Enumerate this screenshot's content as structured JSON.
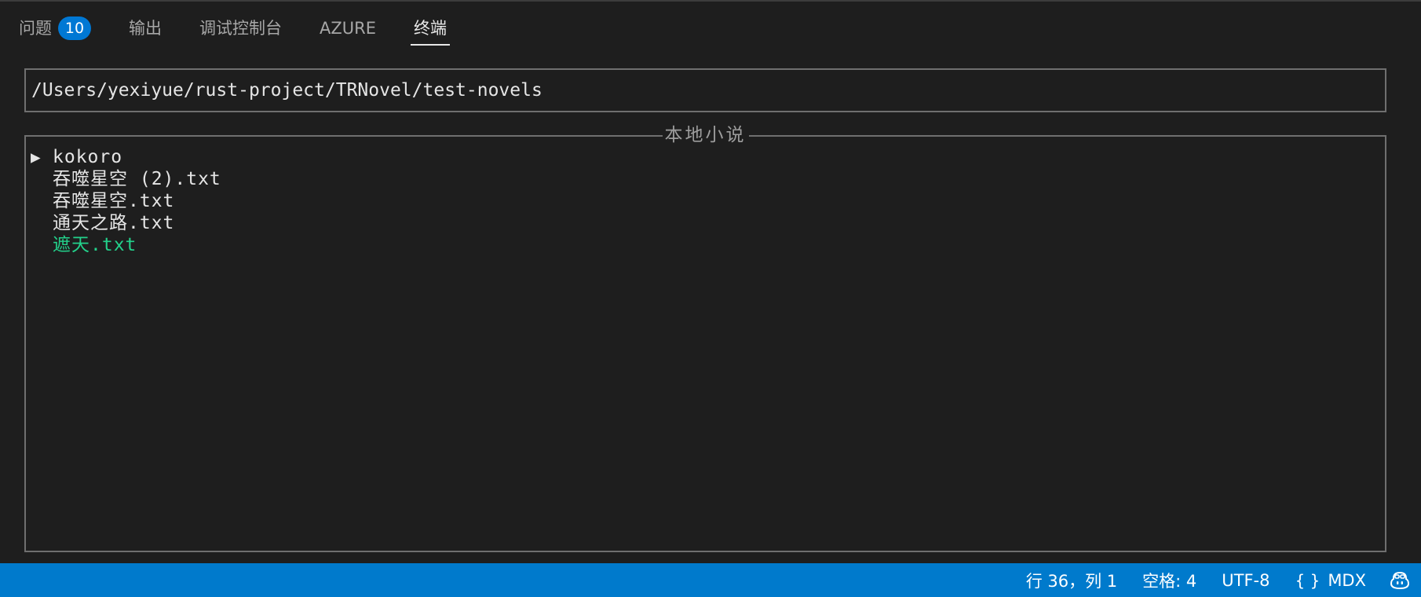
{
  "panel": {
    "tabs": [
      {
        "label": "问题",
        "badge": "10"
      },
      {
        "label": "输出"
      },
      {
        "label": "调试控制台"
      },
      {
        "label": "AZURE"
      },
      {
        "label": "终端"
      }
    ]
  },
  "terminal": {
    "path": "/Users/yexiyue/rust-project/TRNovel/test-novels",
    "list_title": "本地小说",
    "items": [
      {
        "marker": "▶",
        "label": "kokoro"
      },
      {
        "marker": "",
        "label": "吞噬星空 (2).txt"
      },
      {
        "marker": "",
        "label": "吞噬星空.txt"
      },
      {
        "marker": "",
        "label": "通天之路.txt"
      },
      {
        "marker": "",
        "label": "遮天.txt"
      }
    ],
    "selected_color": "#23d18b"
  },
  "status_bar": {
    "position": "行 36，列 1",
    "indent": "空格: 4",
    "encoding": "UTF-8",
    "language_icon": "{ }",
    "language": "MDX",
    "copilot_icon": "copilot-icon",
    "background": "#007acc"
  }
}
